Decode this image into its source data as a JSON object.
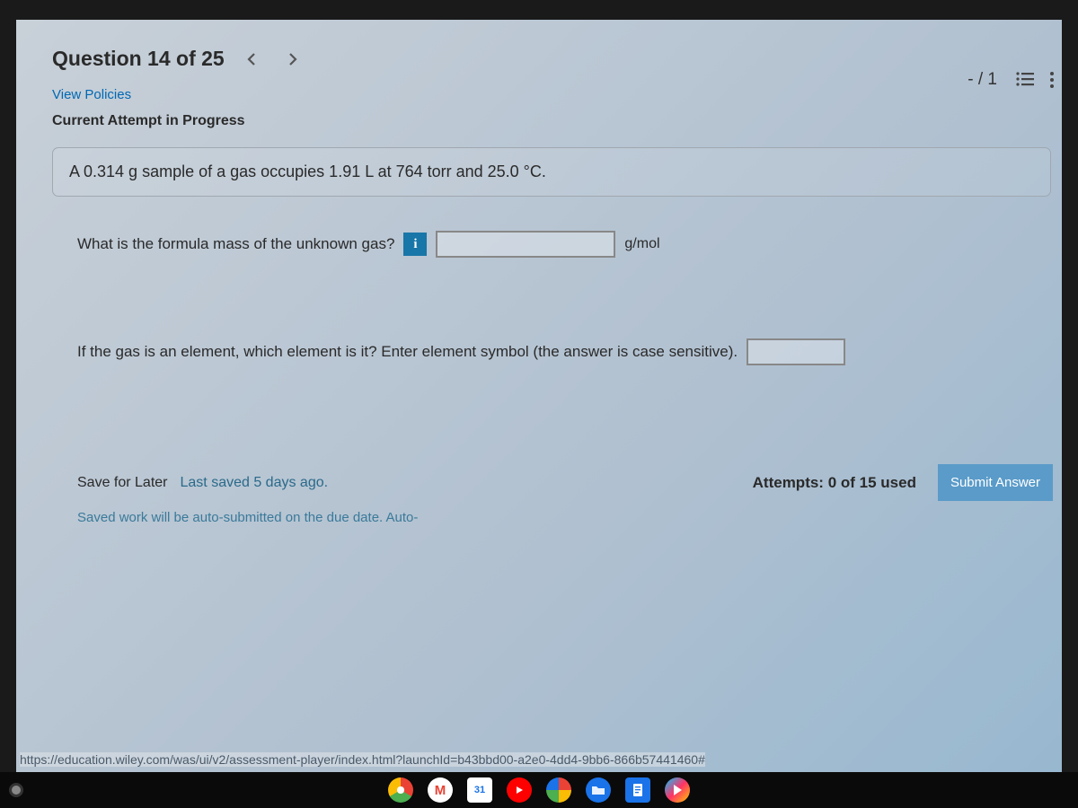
{
  "header": {
    "question_title": "Question 14 of 25",
    "score": "- / 1"
  },
  "links": {
    "view_policies": "View Policies"
  },
  "attempt_label": "Current Attempt in Progress",
  "prompt_text": "A 0.314 g sample of a gas occupies 1.91 L at 764 torr and 25.0 °C.",
  "q1": {
    "text": "What is the formula mass of the unknown gas?",
    "unit": "g/mol"
  },
  "q2": {
    "text": "If the gas is an element, which element is it? Enter element symbol (the answer is case sensitive)."
  },
  "footer": {
    "save_for_later": "Save for Later",
    "last_saved": "Last saved 5 days ago.",
    "attempts": "Attempts: 0 of 15 used",
    "submit": "Submit Answer",
    "auto_note": "Saved work will be auto-submitted on the due date. Auto-"
  },
  "status_url": "https://education.wiley.com/was/ui/v2/assessment-player/index.html?launchId=b43bbd00-a2e0-4dd4-9bb6-866b57441460#",
  "taskbar": {
    "calendar_day": "31"
  }
}
